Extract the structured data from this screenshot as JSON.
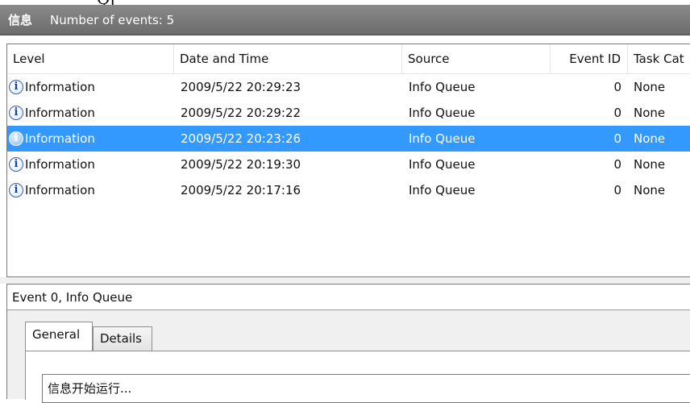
{
  "header": {
    "log_name": "信息",
    "event_count": "Number of events: 5"
  },
  "columns": {
    "level": "Level",
    "date_time": "Date and Time",
    "source": "Source",
    "event_id": "Event ID",
    "task_category": "Task Cat"
  },
  "events": [
    {
      "level": "Information",
      "date_time": "2009/5/22 20:29:23",
      "source": "Info Queue",
      "event_id": "0",
      "task": "None",
      "selected": false
    },
    {
      "level": "Information",
      "date_time": "2009/5/22 20:29:22",
      "source": "Info Queue",
      "event_id": "0",
      "task": "None",
      "selected": false
    },
    {
      "level": "Information",
      "date_time": "2009/5/22 20:23:26",
      "source": "Info Queue",
      "event_id": "0",
      "task": "None",
      "selected": true
    },
    {
      "level": "Information",
      "date_time": "2009/5/22 20:19:30",
      "source": "Info Queue",
      "event_id": "0",
      "task": "None",
      "selected": false
    },
    {
      "level": "Information",
      "date_time": "2009/5/22 20:17:16",
      "source": "Info Queue",
      "event_id": "0",
      "task": "None",
      "selected": false
    }
  ],
  "detail": {
    "title": "Event 0, Info Queue",
    "tabs": [
      "General",
      "Details"
    ],
    "active_tab": "General",
    "message": "信息开始运行..."
  },
  "icons": {
    "level_icon": "information-icon"
  },
  "colors": {
    "selection": "#3399ff",
    "header_bar": "#7a7a7a"
  }
}
